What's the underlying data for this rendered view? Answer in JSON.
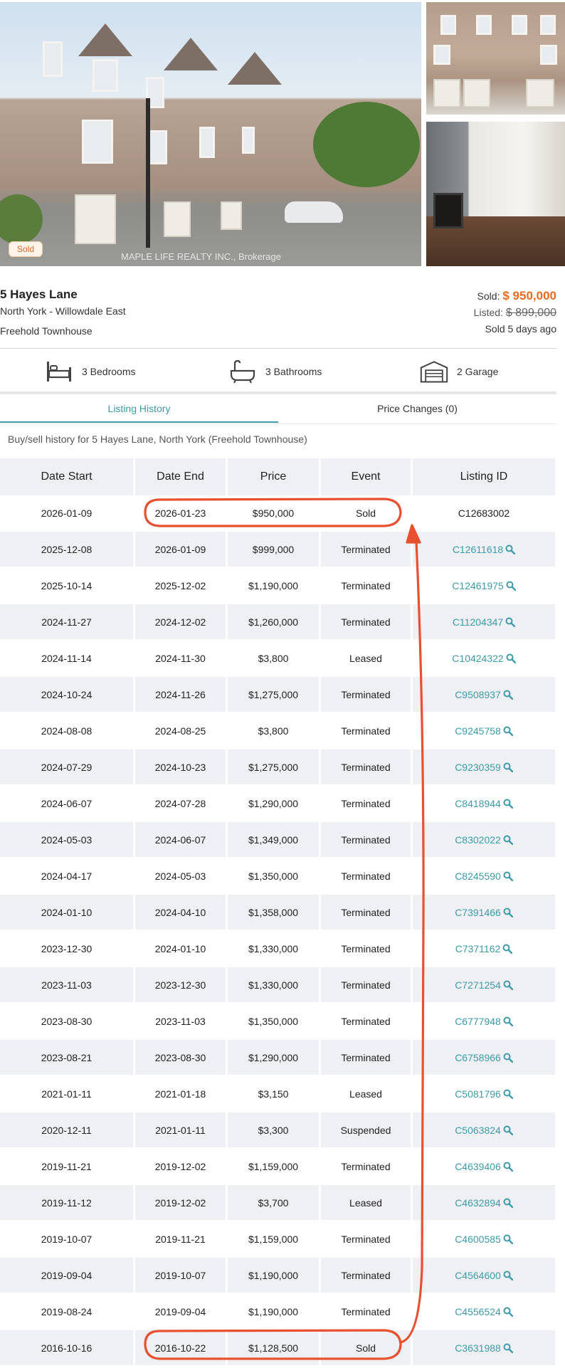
{
  "gallery": {
    "badge": "Sold",
    "watermark_main": "MAPLE LIFE REALTY INC., Brokerage",
    "watermark_small": "MAPLE LIFE REALTY INC."
  },
  "listing": {
    "address": "5 Hayes Lane",
    "area": "North York - Willowdale East",
    "type": "Freehold Townhouse",
    "sold_label": "Sold:",
    "sold_price": "$ 950,000",
    "listed_label": "Listed:",
    "listed_price": "$ 899,000",
    "sold_ago": "Sold 5 days ago"
  },
  "features": [
    {
      "icon": "bed-icon",
      "label": "3 Bedrooms"
    },
    {
      "icon": "bathtub-icon",
      "label": "3 Bathrooms"
    },
    {
      "icon": "garage-icon",
      "label": "2 Garage"
    }
  ],
  "tabs": [
    {
      "label": "Listing History",
      "active": true
    },
    {
      "label": "Price Changes (0)",
      "active": false
    }
  ],
  "history": {
    "caption": "Buy/sell history for 5 Hayes Lane, North York (Freehold Townhouse)",
    "columns": [
      "Date Start",
      "Date End",
      "Price",
      "Event",
      "Listing ID"
    ],
    "rows": [
      {
        "start": "2026-01-09",
        "end": "2026-01-23",
        "price": "$950,000",
        "event": "Sold",
        "id": "C12683002",
        "link": false
      },
      {
        "start": "2025-12-08",
        "end": "2026-01-09",
        "price": "$999,000",
        "event": "Terminated",
        "id": "C12611618",
        "link": true
      },
      {
        "start": "2025-10-14",
        "end": "2025-12-02",
        "price": "$1,190,000",
        "event": "Terminated",
        "id": "C12461975",
        "link": true
      },
      {
        "start": "2024-11-27",
        "end": "2024-12-02",
        "price": "$1,260,000",
        "event": "Terminated",
        "id": "C11204347",
        "link": true
      },
      {
        "start": "2024-11-14",
        "end": "2024-11-30",
        "price": "$3,800",
        "event": "Leased",
        "id": "C10424322",
        "link": true
      },
      {
        "start": "2024-10-24",
        "end": "2024-11-26",
        "price": "$1,275,000",
        "event": "Terminated",
        "id": "C9508937",
        "link": true
      },
      {
        "start": "2024-08-08",
        "end": "2024-08-25",
        "price": "$3,800",
        "event": "Terminated",
        "id": "C9245758",
        "link": true
      },
      {
        "start": "2024-07-29",
        "end": "2024-10-23",
        "price": "$1,275,000",
        "event": "Terminated",
        "id": "C9230359",
        "link": true
      },
      {
        "start": "2024-06-07",
        "end": "2024-07-28",
        "price": "$1,290,000",
        "event": "Terminated",
        "id": "C8418944",
        "link": true
      },
      {
        "start": "2024-05-03",
        "end": "2024-06-07",
        "price": "$1,349,000",
        "event": "Terminated",
        "id": "C8302022",
        "link": true
      },
      {
        "start": "2024-04-17",
        "end": "2024-05-03",
        "price": "$1,350,000",
        "event": "Terminated",
        "id": "C8245590",
        "link": true
      },
      {
        "start": "2024-01-10",
        "end": "2024-04-10",
        "price": "$1,358,000",
        "event": "Terminated",
        "id": "C7391466",
        "link": true
      },
      {
        "start": "2023-12-30",
        "end": "2024-01-10",
        "price": "$1,330,000",
        "event": "Terminated",
        "id": "C7371162",
        "link": true
      },
      {
        "start": "2023-11-03",
        "end": "2023-12-30",
        "price": "$1,330,000",
        "event": "Terminated",
        "id": "C7271254",
        "link": true
      },
      {
        "start": "2023-08-30",
        "end": "2023-11-03",
        "price": "$1,350,000",
        "event": "Terminated",
        "id": "C6777948",
        "link": true
      },
      {
        "start": "2023-08-21",
        "end": "2023-08-30",
        "price": "$1,290,000",
        "event": "Terminated",
        "id": "C6758966",
        "link": true
      },
      {
        "start": "2021-01-11",
        "end": "2021-01-18",
        "price": "$3,150",
        "event": "Leased",
        "id": "C5081796",
        "link": true
      },
      {
        "start": "2020-12-11",
        "end": "2021-01-11",
        "price": "$3,300",
        "event": "Suspended",
        "id": "C5063824",
        "link": true
      },
      {
        "start": "2019-11-21",
        "end": "2019-12-02",
        "price": "$1,159,000",
        "event": "Terminated",
        "id": "C4639406",
        "link": true
      },
      {
        "start": "2019-11-12",
        "end": "2019-12-02",
        "price": "$3,700",
        "event": "Leased",
        "id": "C4632894",
        "link": true
      },
      {
        "start": "2019-10-07",
        "end": "2019-11-21",
        "price": "$1,159,000",
        "event": "Terminated",
        "id": "C4600585",
        "link": true
      },
      {
        "start": "2019-09-04",
        "end": "2019-10-07",
        "price": "$1,190,000",
        "event": "Terminated",
        "id": "C4564600",
        "link": true
      },
      {
        "start": "2019-08-24",
        "end": "2019-09-04",
        "price": "$1,190,000",
        "event": "Terminated",
        "id": "C4556524",
        "link": true
      },
      {
        "start": "2016-10-16",
        "end": "2016-10-22",
        "price": "$1,128,500",
        "event": "Sold",
        "id": "C3631988",
        "link": true
      }
    ]
  },
  "colors": {
    "accent": "#3d9bab",
    "sold_price": "#ea6a22",
    "annotation": "#e8502f",
    "row_alt": "#eff0f4"
  }
}
